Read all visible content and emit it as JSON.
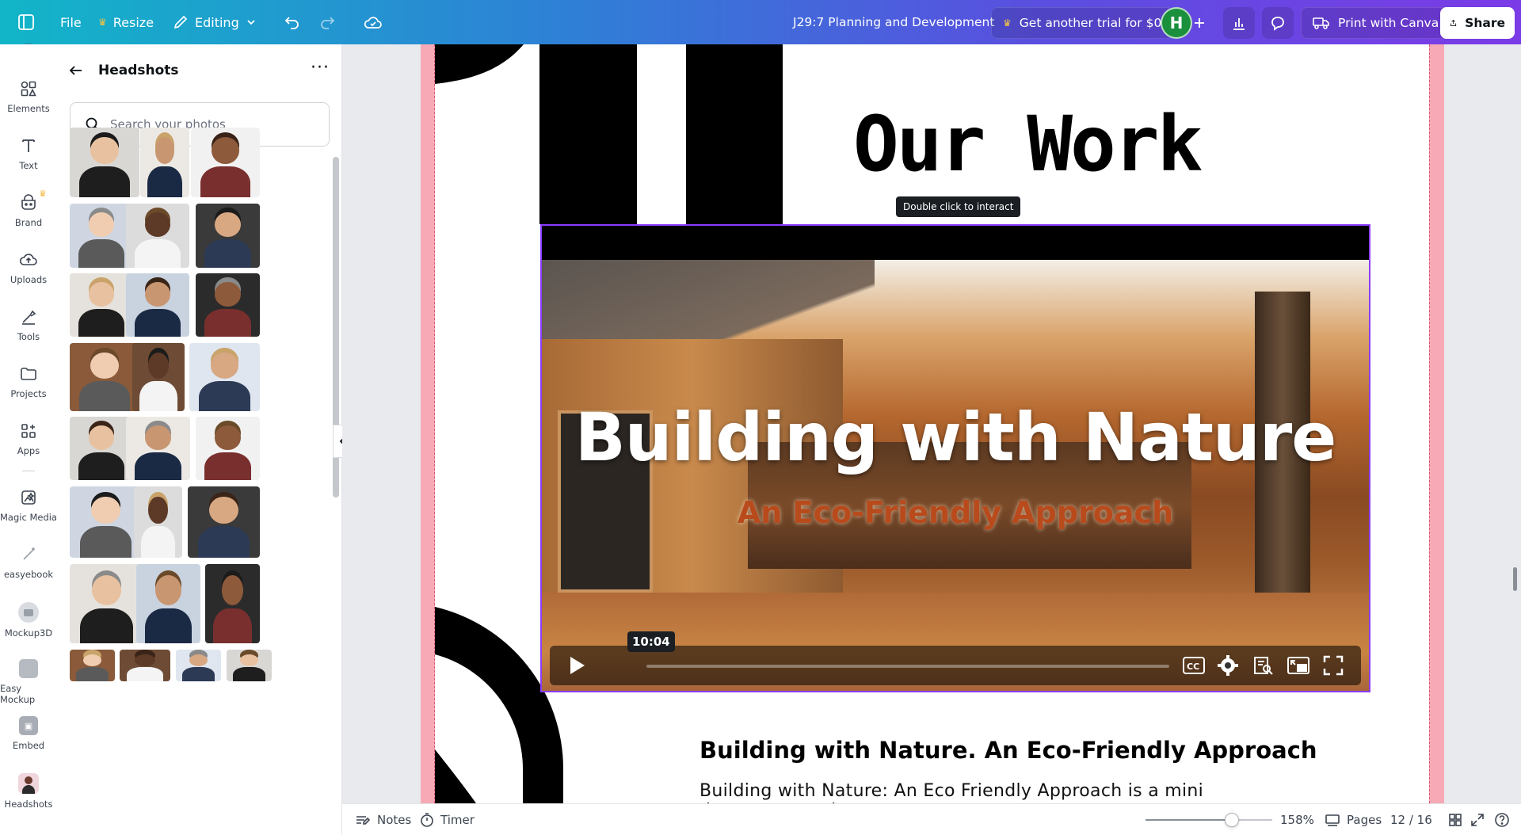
{
  "topbar": {
    "file_label": "File",
    "resize_label": "Resize",
    "editing_label": "Editing",
    "doc_title": "J29:7 Planning and Development",
    "trial_label": "Get another trial for $0",
    "avatar_initial": "H",
    "print_label": "Print with Canva",
    "share_label": "Share"
  },
  "rail": {
    "items": [
      {
        "label": "Elements",
        "icon": "elements-icon"
      },
      {
        "label": "Text",
        "icon": "text-icon"
      },
      {
        "label": "Brand",
        "icon": "brand-icon"
      },
      {
        "label": "Uploads",
        "icon": "uploads-icon"
      },
      {
        "label": "Tools",
        "icon": "tools-icon"
      },
      {
        "label": "Projects",
        "icon": "projects-icon"
      },
      {
        "label": "Apps",
        "icon": "apps-icon"
      },
      {
        "label": "Magic Media",
        "icon": "magic-media-icon"
      },
      {
        "label": "easyebook",
        "icon": "easyebook-icon"
      },
      {
        "label": "Mockup3D",
        "icon": "mockup3d-icon"
      },
      {
        "label": "Easy Mockup",
        "icon": "easy-mockup-icon"
      },
      {
        "label": "Embed",
        "icon": "embed-icon"
      },
      {
        "label": "Headshots",
        "icon": "headshots-icon"
      }
    ]
  },
  "panel": {
    "title": "Headshots",
    "search_placeholder": "Search your photos"
  },
  "slide": {
    "heading": "Our Work",
    "tooltip": "Double click to interact",
    "video_title": "Building with Nature",
    "video_subtitle": "An Eco-Friendly Approach",
    "video_time": "10:04",
    "subheading": "Building with Nature. An Eco-Friendly Approach",
    "body_text": "Building with Nature: An Eco Friendly Approach is a mini documentary that"
  },
  "bottombar": {
    "notes_label": "Notes",
    "timer_label": "Timer",
    "zoom_label": "158%",
    "zoom_fraction": 0.68,
    "pages_label": "Pages",
    "page_counter": "12 / 16"
  },
  "colors": {
    "accent_pink": "#f7a9b5",
    "selection_purple": "#8b3dff",
    "avatar_green": "#1a8f3c"
  }
}
